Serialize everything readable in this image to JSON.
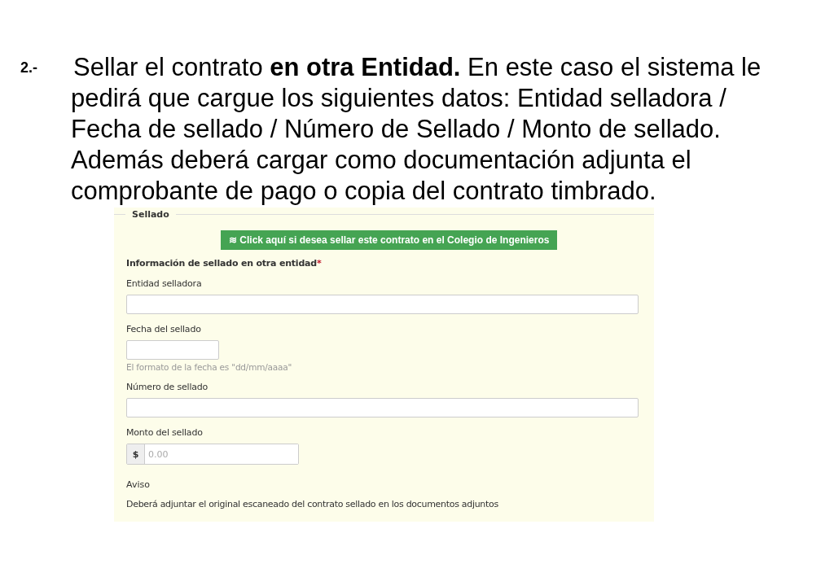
{
  "step": {
    "number": "2.-",
    "text": "Sellar el contrato **en otra Entidad.** En este caso el sistema le\npedirá que cargue los siguientes datos: Entidad selladora /\nFecha de sellado / Número de Sellado / Monto de sellado.\nAdemás deberá cargar como documentación adjunta el\ncomprobante de pago o copia del contrato timbrado."
  },
  "form": {
    "legend": "Sellado",
    "button": {
      "icon": "≋",
      "label": "Click aquí si desea sellar este contrato en el Colegio de Ingenieros"
    },
    "section_title": "Información de sellado en otra entidad",
    "required_mark": "*",
    "fields": [
      {
        "kind": "wide",
        "label": "Entidad selladora"
      },
      {
        "kind": "short",
        "label": "Fecha del sellado",
        "help": "El formato de la fecha es \"dd/mm/aaaa\""
      },
      {
        "kind": "wide",
        "label": "Número de sellado"
      },
      {
        "kind": "money",
        "label": "Monto del sellado",
        "addon": "$",
        "placeholder": "0.00"
      }
    ],
    "notice_title": "Aviso",
    "notice": "Deberá adjuntar el original escaneado del contrato sellado en los documentos adjuntos"
  }
}
